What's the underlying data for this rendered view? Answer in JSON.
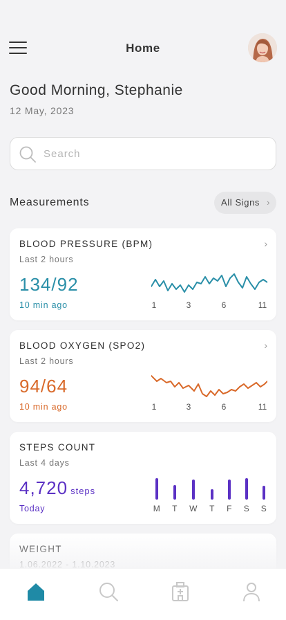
{
  "header": {
    "title": "Home",
    "menu_icon": "hamburger-menu-icon",
    "avatar": "user-avatar"
  },
  "greeting": "Good Morning, Stephanie",
  "date": "12 May, 2023",
  "search": {
    "placeholder": "Search",
    "icon": "search-icon"
  },
  "measurements": {
    "title": "Measurements",
    "all_signs_label": "All Signs"
  },
  "cards": [
    {
      "title": "BLOOD PRESSURE (BPM)",
      "subtitle": "Last 2 hours",
      "value": "134/92",
      "time": "10 min ago",
      "color": "#2a8fa8",
      "x_labels": [
        "1",
        "3",
        "6",
        "11"
      ]
    },
    {
      "title": "BLOOD OXYGEN (SPO2)",
      "subtitle": "Last 2 hours",
      "value": "94/64",
      "time": "10 min ago",
      "color": "#d96a2b",
      "x_labels": [
        "1",
        "3",
        "6",
        "11"
      ]
    },
    {
      "title": "STEPS COUNT",
      "subtitle": "Last 4 days",
      "value": "4,720",
      "unit": "steps",
      "time": "Today",
      "color": "#5b31c4",
      "days": [
        "M",
        "T",
        "W",
        "T",
        "F",
        "S",
        "S"
      ]
    },
    {
      "title": "WEIGHT",
      "subtitle": "1.06.2022 - 1.10.2023"
    }
  ],
  "tabbar": {
    "active_color": "#1f8aa6",
    "inactive_color": "#c8c8c8",
    "items": [
      "home-icon",
      "search-icon",
      "hospital-icon",
      "profile-icon"
    ]
  }
}
